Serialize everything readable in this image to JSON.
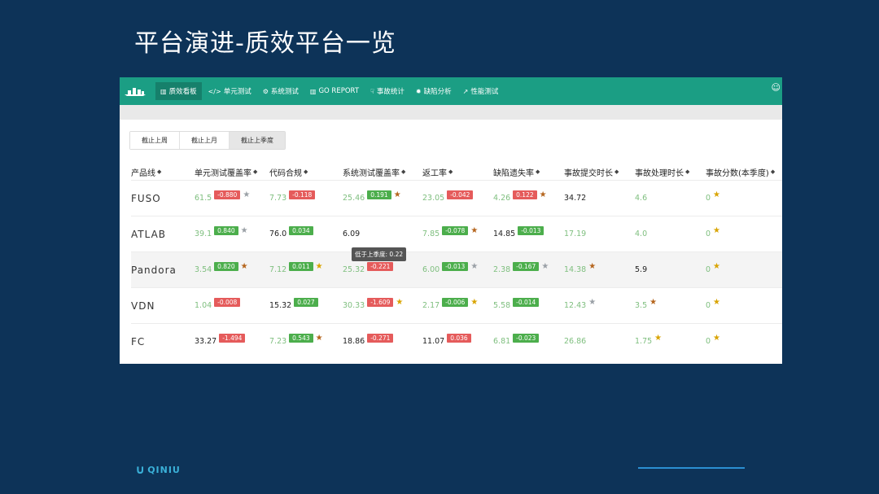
{
  "slide": {
    "title": "平台演进-质效平台一览"
  },
  "nav": {
    "items": [
      {
        "icon": "bar-chart",
        "label": "质效看板",
        "active": true
      },
      {
        "icon": "code",
        "label": "单元测试"
      },
      {
        "icon": "gears",
        "label": "系统测试"
      },
      {
        "icon": "bar-chart",
        "label": "GO REPORT"
      },
      {
        "icon": "thumbs-down",
        "label": "事故统计"
      },
      {
        "icon": "bug",
        "label": "缺陷分析"
      },
      {
        "icon": "line-chart",
        "label": "性能测试"
      }
    ]
  },
  "tabs": [
    "截止上周",
    "截止上月",
    "截止上季度"
  ],
  "active_tab": "截止上季度",
  "table": {
    "headers": [
      "产品线",
      "单元测试覆盖率",
      "代码合规",
      "系统测试覆盖率",
      "返工率",
      "缺陷遗失率",
      "事故提交时长",
      "事故处理时长",
      "事故分数(本季度)"
    ],
    "rows": [
      {
        "name": "FUSO",
        "cells": [
          {
            "value": "61.5",
            "badge": "-0.880",
            "badge_color": "red",
            "medal": "silver"
          },
          {
            "value": "7.73",
            "badge": "-0.118",
            "badge_color": "red",
            "medal": ""
          },
          {
            "value": "25.46",
            "badge": "0.191",
            "badge_color": "green",
            "medal": "bronze"
          },
          {
            "value": "23.05",
            "badge": "-0.042",
            "badge_color": "red",
            "medal": ""
          },
          {
            "value": "4.26",
            "badge": "0.122",
            "badge_color": "red",
            "medal": "bronze"
          },
          {
            "value": "34.72",
            "badge": "",
            "badge_color": "",
            "medal": "",
            "dark": true
          },
          {
            "value": "4.6",
            "badge": "",
            "badge_color": "",
            "medal": ""
          },
          {
            "value": "0",
            "badge": "",
            "badge_color": "",
            "medal": "gold"
          }
        ]
      },
      {
        "name": "ATLAB",
        "cells": [
          {
            "value": "39.1",
            "badge": "0.840",
            "badge_color": "green",
            "medal": "silver"
          },
          {
            "value": "76.0",
            "badge": "0.034",
            "badge_color": "green",
            "medal": "",
            "dark": true
          },
          {
            "value": "6.09",
            "badge": "",
            "badge_color": "",
            "medal": "",
            "dark": true
          },
          {
            "value": "7.85",
            "badge": "-0.078",
            "badge_color": "green",
            "medal": "bronze"
          },
          {
            "value": "14.85",
            "badge": "-0.013",
            "badge_color": "green",
            "medal": "",
            "dark": true
          },
          {
            "value": "17.19",
            "badge": "",
            "badge_color": "",
            "medal": ""
          },
          {
            "value": "4.0",
            "badge": "",
            "badge_color": "",
            "medal": ""
          },
          {
            "value": "0",
            "badge": "",
            "badge_color": "",
            "medal": "gold"
          }
        ]
      },
      {
        "name": "Pandora",
        "cells": [
          {
            "value": "3.54",
            "badge": "0.820",
            "badge_color": "green",
            "medal": "bronze"
          },
          {
            "value": "7.12",
            "badge": "0.011",
            "badge_color": "green",
            "medal": "gold"
          },
          {
            "value": "25.32",
            "badge": "-0.221",
            "badge_color": "red",
            "medal": ""
          },
          {
            "value": "6.00",
            "badge": "-0.013",
            "badge_color": "green",
            "medal": "silver"
          },
          {
            "value": "2.38",
            "badge": "-0.167",
            "badge_color": "green",
            "medal": "silver"
          },
          {
            "value": "14.38",
            "badge": "",
            "badge_color": "",
            "medal": "bronze"
          },
          {
            "value": "5.9",
            "badge": "",
            "badge_color": "",
            "medal": "",
            "dark": true
          },
          {
            "value": "0",
            "badge": "",
            "badge_color": "",
            "medal": "gold"
          }
        ]
      },
      {
        "name": "VDN",
        "cells": [
          {
            "value": "1.04",
            "badge": "-0.008",
            "badge_color": "red",
            "medal": ""
          },
          {
            "value": "15.32",
            "badge": "0.027",
            "badge_color": "green",
            "medal": "",
            "dark": true
          },
          {
            "value": "30.33",
            "badge": "-1.609",
            "badge_color": "red",
            "medal": "gold"
          },
          {
            "value": "2.17",
            "badge": "-0.006",
            "badge_color": "green",
            "medal": "gold"
          },
          {
            "value": "5.58",
            "badge": "-0.014",
            "badge_color": "green",
            "medal": ""
          },
          {
            "value": "12.43",
            "badge": "",
            "badge_color": "",
            "medal": "silver"
          },
          {
            "value": "3.5",
            "badge": "",
            "badge_color": "",
            "medal": "bronze"
          },
          {
            "value": "0",
            "badge": "",
            "badge_color": "",
            "medal": "gold"
          }
        ]
      },
      {
        "name": "FC",
        "cells": [
          {
            "value": "33.27",
            "badge": "-1.494",
            "badge_color": "red",
            "medal": "",
            "dark": true
          },
          {
            "value": "7.23",
            "badge": "0.543",
            "badge_color": "green",
            "medal": "bronze"
          },
          {
            "value": "18.86",
            "badge": "-0.271",
            "badge_color": "red",
            "medal": "",
            "dark": true
          },
          {
            "value": "11.07",
            "badge": "0.036",
            "badge_color": "red",
            "medal": "",
            "dark": true
          },
          {
            "value": "6.81",
            "badge": "-0.023",
            "badge_color": "green",
            "medal": ""
          },
          {
            "value": "26.86",
            "badge": "",
            "badge_color": "",
            "medal": ""
          },
          {
            "value": "1.75",
            "badge": "",
            "badge_color": "",
            "medal": "gold"
          },
          {
            "value": "0",
            "badge": "",
            "badge_color": "",
            "medal": "gold"
          }
        ]
      }
    ]
  },
  "tooltip": {
    "text": "低于上季度: 0.22"
  },
  "footer": {
    "brand": "QINIU"
  },
  "colors": {
    "navbar": "#1b9e84",
    "background": "#0d3358",
    "green_badge": "#4cae4c",
    "red_badge": "#e55b5b",
    "accent_line": "#2b8fd1"
  }
}
